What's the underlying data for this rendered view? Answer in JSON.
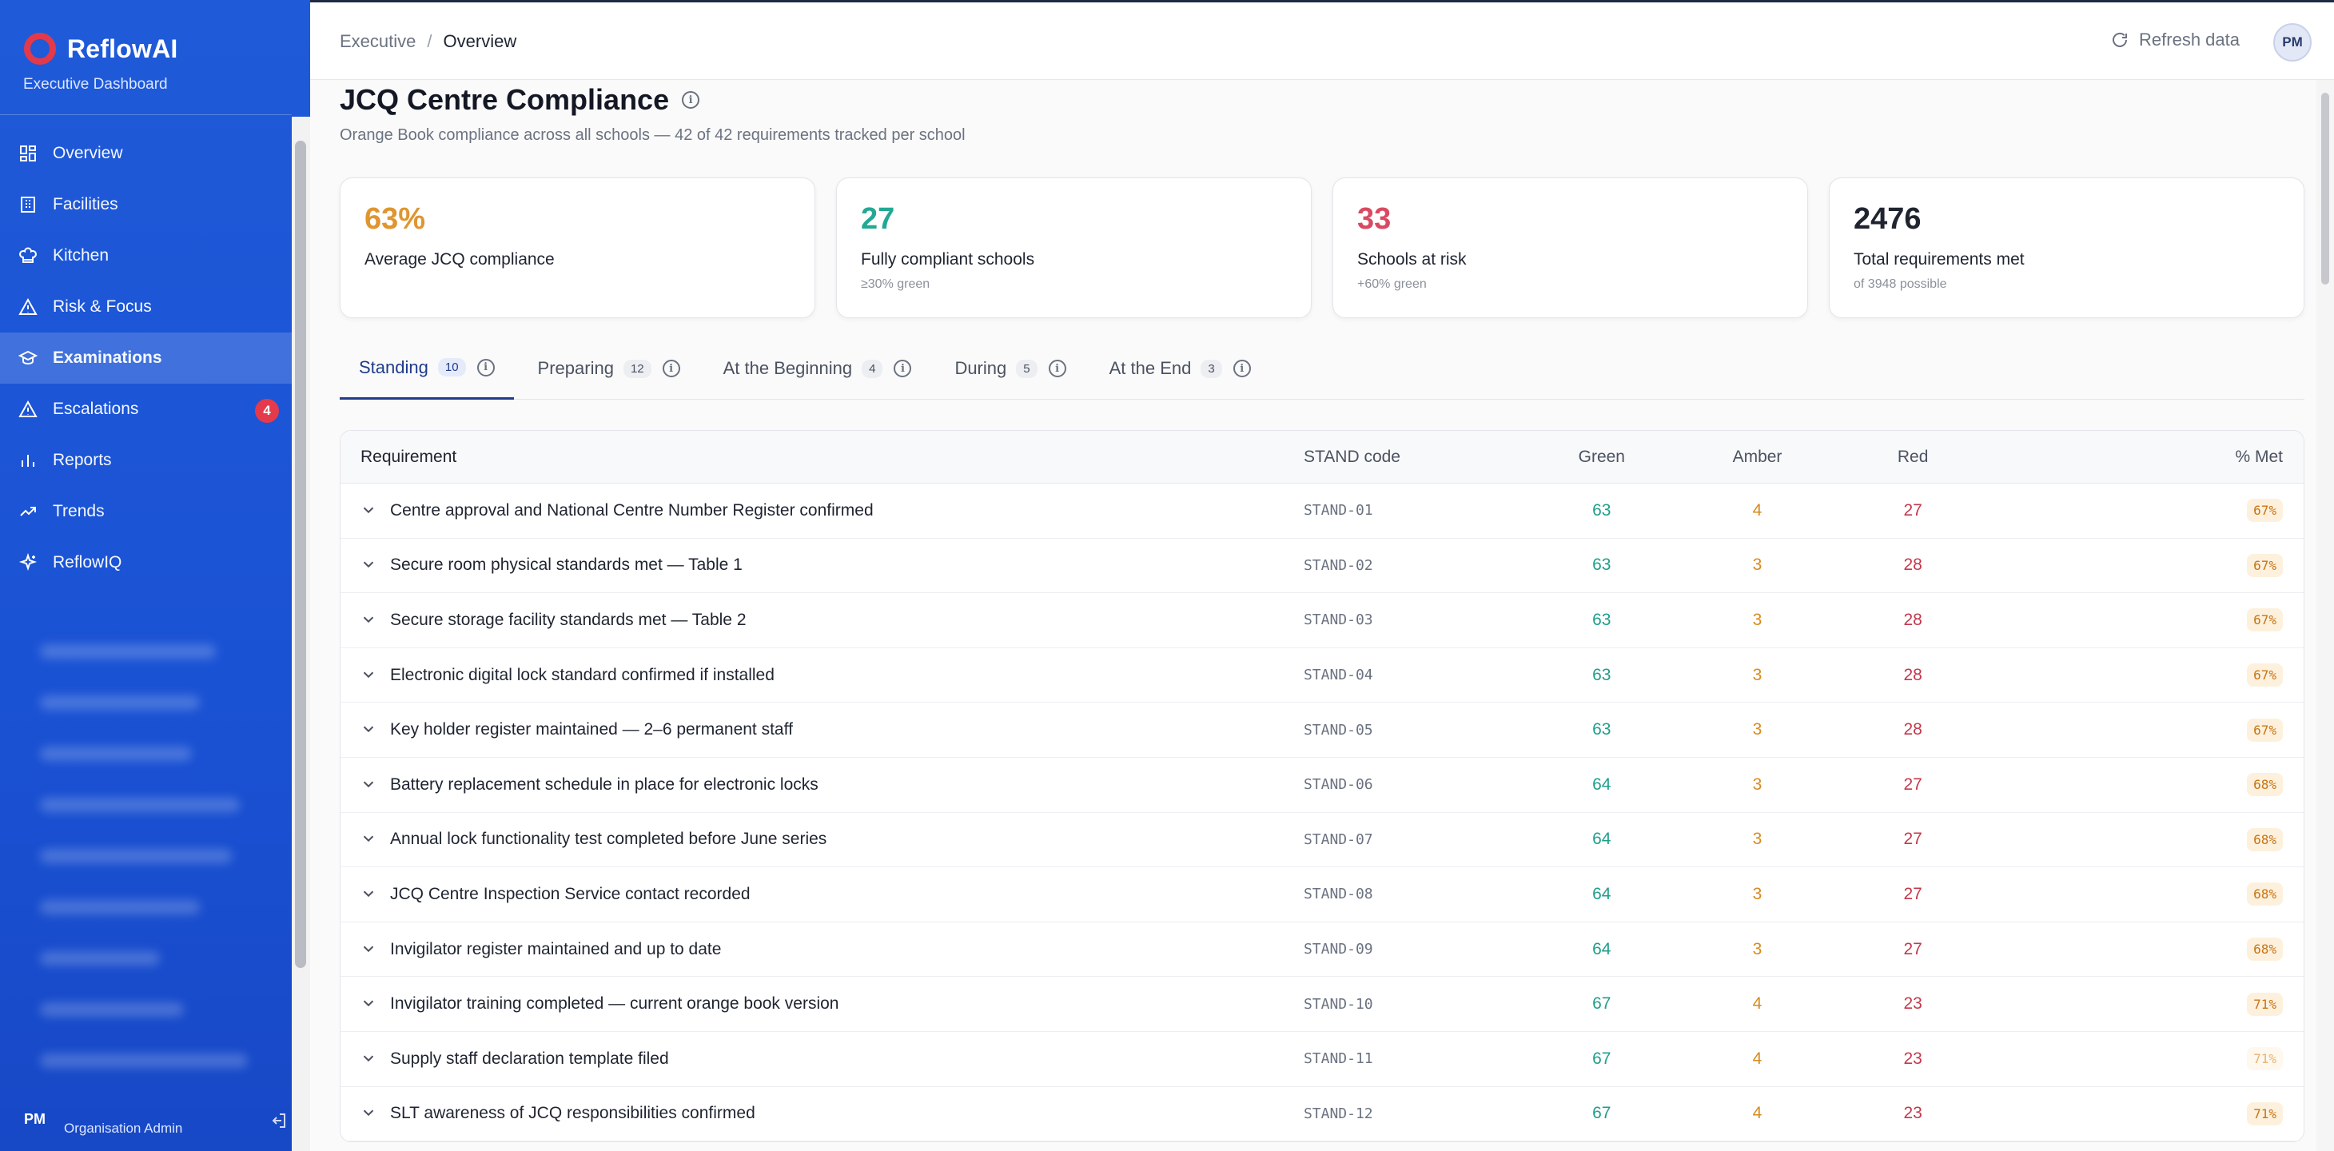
{
  "brand": {
    "name": "ReflowAI",
    "subtitle": "Executive Dashboard"
  },
  "sidebar": {
    "items": [
      {
        "label": "Overview",
        "icon": "grid-icon"
      },
      {
        "label": "Facilities",
        "icon": "building-icon"
      },
      {
        "label": "Kitchen",
        "icon": "chef-hat-icon"
      },
      {
        "label": "Risk & Focus",
        "icon": "warning-icon"
      },
      {
        "label": "Examinations",
        "icon": "graduation-cap-icon",
        "active": true
      },
      {
        "label": "Escalations",
        "icon": "warning-icon",
        "badge": "4"
      },
      {
        "label": "Reports",
        "icon": "bar-chart-icon"
      },
      {
        "label": "Trends",
        "icon": "trend-up-icon"
      },
      {
        "label": "ReflowIQ",
        "icon": "sparkle-icon"
      }
    ],
    "user": {
      "initials": "PM",
      "role": "Organisation Admin"
    }
  },
  "topbar": {
    "breadcrumb": [
      "Executive",
      "Overview"
    ],
    "refresh_label": "Refresh data",
    "avatar_initials": "PM"
  },
  "page": {
    "title": "JCQ Centre Compliance",
    "subtitle": "Orange Book compliance across all schools — 42 of 42 requirements tracked per school"
  },
  "kpis": [
    {
      "value": "63%",
      "label": "Average JCQ compliance",
      "note": "",
      "color": "#e0952f"
    },
    {
      "value": "27",
      "label": "Fully compliant schools",
      "note": "≥30% green",
      "color": "#22a993"
    },
    {
      "value": "33",
      "label": "Schools at risk",
      "note": "+60% green",
      "color": "#d94a62"
    },
    {
      "value": "2476",
      "label": "Total requirements met",
      "note": "of 3948 possible",
      "color": "#1f2430"
    }
  ],
  "tabs": [
    {
      "label": "Standing",
      "count": "10",
      "active": true
    },
    {
      "label": "Preparing",
      "count": "12"
    },
    {
      "label": "At the Beginning",
      "count": "4"
    },
    {
      "label": "During",
      "count": "5"
    },
    {
      "label": "At the End",
      "count": "3"
    }
  ],
  "table": {
    "headers": {
      "requirement": "Requirement",
      "code": "STAND code",
      "green": "Green",
      "amber": "Amber",
      "red": "Red",
      "met": "% Met"
    },
    "rows": [
      {
        "requirement": "Centre approval and National Centre Number Register confirmed",
        "code": "STAND-01",
        "green": "63",
        "amber": "4",
        "red": "27",
        "met": "67%"
      },
      {
        "requirement": "Secure room physical standards met — Table 1",
        "code": "STAND-02",
        "green": "63",
        "amber": "3",
        "red": "28",
        "met": "67%"
      },
      {
        "requirement": "Secure storage facility standards met — Table 2",
        "code": "STAND-03",
        "green": "63",
        "amber": "3",
        "red": "28",
        "met": "67%"
      },
      {
        "requirement": "Electronic digital lock standard confirmed if installed",
        "code": "STAND-04",
        "green": "63",
        "amber": "3",
        "red": "28",
        "met": "67%"
      },
      {
        "requirement": "Key holder register maintained — 2–6 permanent staff",
        "code": "STAND-05",
        "green": "63",
        "amber": "3",
        "red": "28",
        "met": "67%"
      },
      {
        "requirement": "Battery replacement schedule in place for electronic locks",
        "code": "STAND-06",
        "green": "64",
        "amber": "3",
        "red": "27",
        "met": "68%"
      },
      {
        "requirement": "Annual lock functionality test completed before June series",
        "code": "STAND-07",
        "green": "64",
        "amber": "3",
        "red": "27",
        "met": "68%"
      },
      {
        "requirement": "JCQ Centre Inspection Service contact recorded",
        "code": "STAND-08",
        "green": "64",
        "amber": "3",
        "red": "27",
        "met": "68%"
      },
      {
        "requirement": "Invigilator register maintained and up to date",
        "code": "STAND-09",
        "green": "64",
        "amber": "3",
        "red": "27",
        "met": "68%"
      },
      {
        "requirement": "Invigilator training completed — current orange book version",
        "code": "STAND-10",
        "green": "67",
        "amber": "4",
        "red": "23",
        "met": "71%"
      },
      {
        "requirement": "Supply staff declaration template filed",
        "code": "STAND-11",
        "green": "67",
        "amber": "4",
        "red": "23",
        "met": "71%",
        "faded": true
      },
      {
        "requirement": "SLT awareness of JCQ responsibilities confirmed",
        "code": "STAND-12",
        "green": "67",
        "amber": "4",
        "red": "23",
        "met": "71%"
      }
    ]
  }
}
